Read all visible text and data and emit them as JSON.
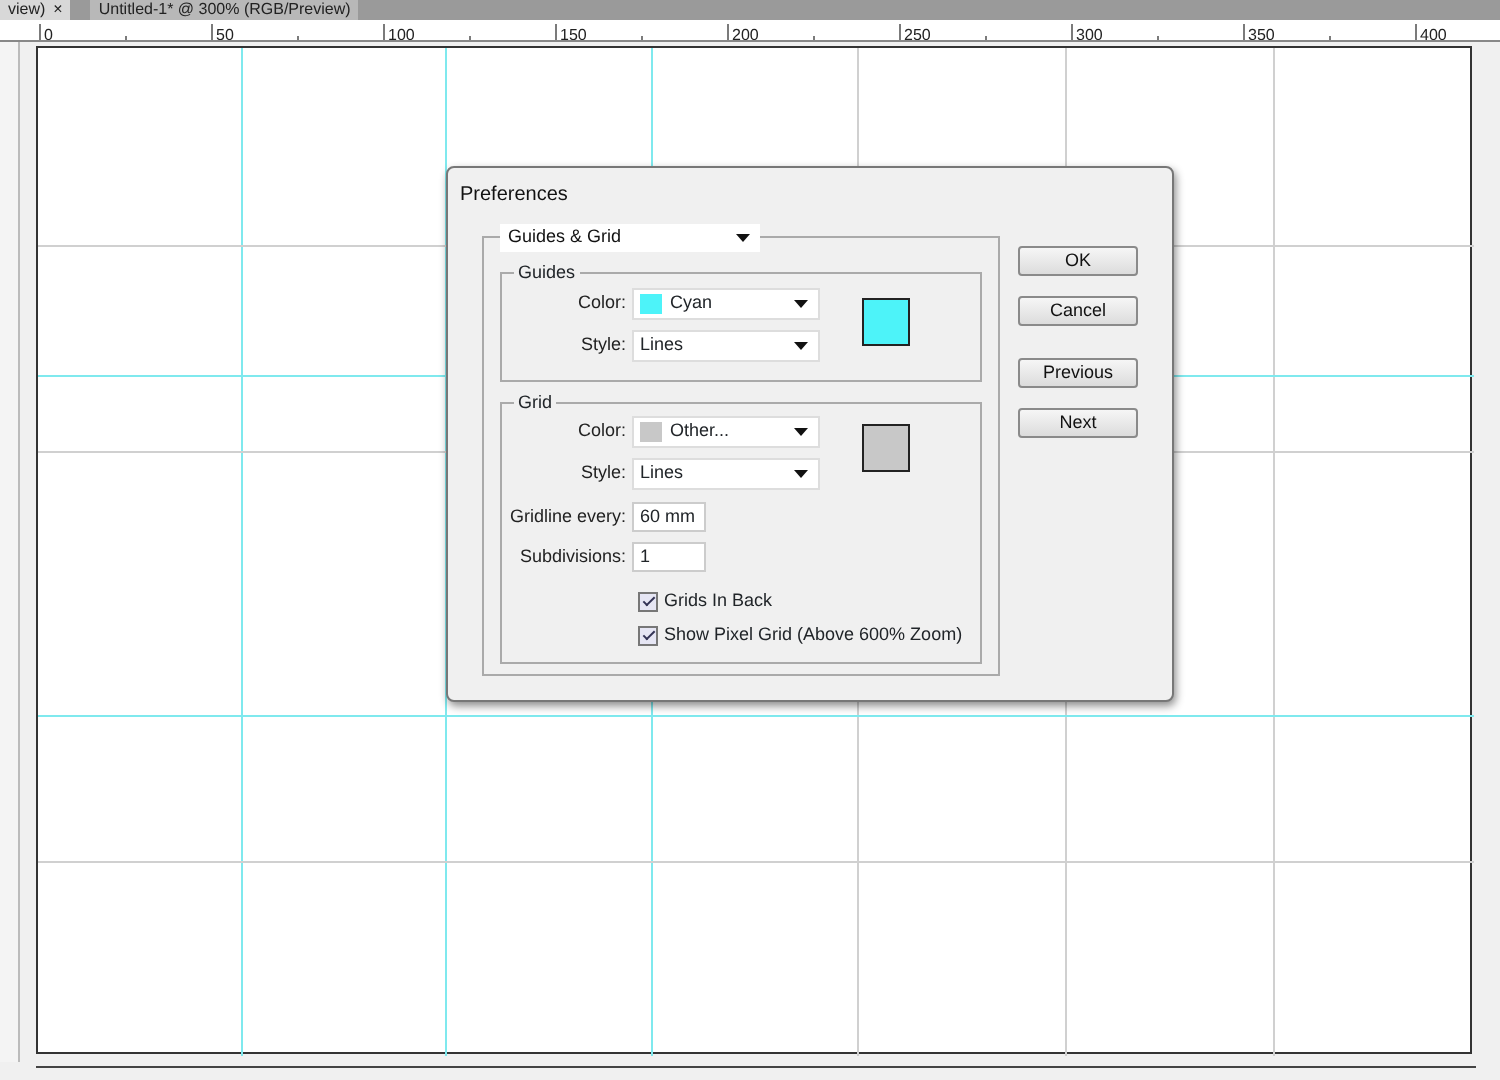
{
  "document_tabs": [
    {
      "label": "view)",
      "close": "×"
    },
    {
      "label": "Untitled-1* @ 300% (RGB/Preview)"
    }
  ],
  "ruler": {
    "labels": [
      "0",
      "50",
      "100",
      "150",
      "200",
      "250",
      "300",
      "350",
      "400"
    ]
  },
  "dialog": {
    "title": "Preferences",
    "section_dropdown": "Guides & Grid",
    "guides": {
      "legend": "Guides",
      "color": {
        "label": "Color:",
        "value": "Cyan",
        "color": "#4df3f9"
      },
      "style": {
        "label": "Style:",
        "value": "Lines"
      }
    },
    "grid": {
      "legend": "Grid",
      "color": {
        "label": "Color:",
        "value": "Other...",
        "color": "#c8c8c8"
      },
      "style": {
        "label": "Style:",
        "value": "Lines"
      },
      "gridline_every": {
        "label": "Gridline every:",
        "value": "60 mm"
      },
      "subdivisions": {
        "label": "Subdivisions:",
        "value": "1"
      },
      "checkboxes": [
        {
          "label": "Grids In Back",
          "checked": true
        },
        {
          "label": "Show Pixel Grid (Above 600% Zoom)",
          "checked": true
        }
      ]
    },
    "button_groups": [
      [
        "OK",
        "Cancel"
      ],
      [
        "Previous",
        "Next"
      ]
    ]
  }
}
